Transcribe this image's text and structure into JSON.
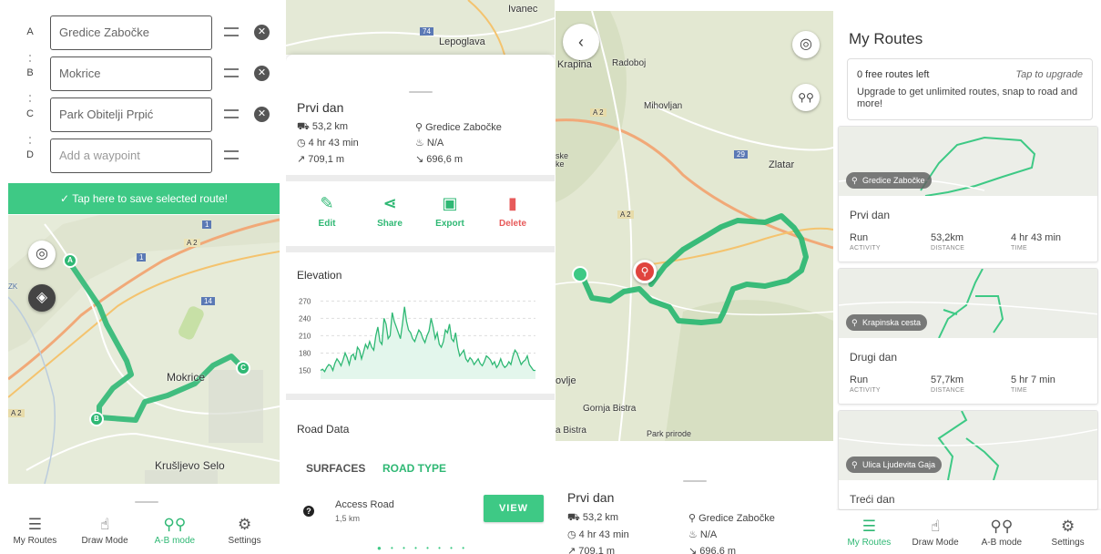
{
  "waypoint_panel": {
    "waypoints": [
      {
        "letter": "A",
        "value": "Gredice Zabočke"
      },
      {
        "letter": "B",
        "value": "Mokrice"
      },
      {
        "letter": "C",
        "value": "Park Obitelji Prpić"
      },
      {
        "letter": "D",
        "placeholder": "Add a waypoint"
      }
    ],
    "save_bar": "✓  Tap here to save selected route!",
    "map_labels": {
      "town1": "Mokrice",
      "town2": "Krušljevo Selo",
      "road_a2": "A 2",
      "road_1": "1",
      "road_14": "14",
      "left_edge": "ZK"
    },
    "markers": [
      "A",
      "B",
      "C"
    ]
  },
  "route_detail": {
    "map_labels": {
      "ivanec": "Ivanec",
      "lepoglava": "Lepoglava",
      "road_74": "74"
    },
    "title": "Prvi dan",
    "stats": {
      "distance": "53,2 km",
      "duration": "4 hr 43 min",
      "ascent": "709,1 m",
      "start": "Gredice Zabočke",
      "calories": "N/A",
      "descent": "696,6 m"
    },
    "actions": {
      "edit": "Edit",
      "share": "Share",
      "export": "Export",
      "delete": "Delete"
    },
    "elevation": {
      "title": "Elevation"
    },
    "road_data": {
      "title": "Road Data",
      "tab_surfaces": "SURFACES",
      "tab_road_type": "ROAD TYPE",
      "item_name": "Access Road",
      "item_length": "1,5 km",
      "view_button": "VIEW"
    },
    "pager": "● • • • • • • •"
  },
  "chart_data": {
    "type": "area",
    "title": "Elevation",
    "xlabel": "",
    "ylabel": "",
    "yticks": [
      150,
      180,
      210,
      240,
      270
    ],
    "ylim": [
      135,
      280
    ],
    "y": [
      150,
      152,
      148,
      155,
      160,
      158,
      150,
      162,
      170,
      165,
      158,
      168,
      180,
      172,
      160,
      175,
      178,
      168,
      190,
      185,
      170,
      182,
      195,
      188,
      200,
      190,
      185,
      210,
      225,
      200,
      195,
      240,
      230,
      205,
      210,
      250,
      235,
      225,
      215,
      205,
      230,
      260,
      235,
      220,
      215,
      205,
      200,
      210,
      220,
      215,
      205,
      198,
      210,
      218,
      240,
      225,
      205,
      215,
      195,
      190,
      200,
      220,
      215,
      230,
      205,
      200,
      215,
      190,
      175,
      180,
      185,
      170,
      165,
      172,
      168,
      160,
      165,
      170,
      162,
      158,
      165,
      175,
      172,
      168,
      160,
      165,
      155,
      160,
      170,
      160,
      155,
      158,
      165,
      160,
      175,
      185,
      180,
      170,
      160,
      165,
      168,
      175,
      160,
      155,
      150,
      150
    ]
  },
  "map_view": {
    "labels": {
      "krapina": "Krapina",
      "radoboj": "Radoboj",
      "mihovljan": "Mihovljan",
      "zlatar": "Zlatar",
      "gornja_bistra": "Gornja Bistra",
      "bistra": "a Bistra",
      "park": "Park prirode",
      "vlje": "ovlje",
      "ske": "ske\nke",
      "road_a2_top": "A 2",
      "road_a2": "A 2",
      "road_29": "29"
    },
    "title": "Prvi dan",
    "stats": {
      "distance": "53,2 km",
      "duration": "4 hr 43 min",
      "ascent": "709,1 m",
      "start": "Gredice Zabočke",
      "calories": "N/A",
      "descent": "696,6 m"
    }
  },
  "my_routes": {
    "title": "My Routes",
    "upgrade": {
      "left": "0 free routes left",
      "tap": "Tap to upgrade",
      "desc": "Upgrade to get unlimited routes, snap to road and more!"
    },
    "routes": [
      {
        "start": "Gredice Zabočke",
        "name": "Prvi dan",
        "activity": "Run",
        "distance": "53,2km",
        "time": "4 hr 43 min"
      },
      {
        "start": "Krapinska cesta",
        "name": "Drugi dan",
        "activity": "Run",
        "distance": "57,7km",
        "time": "5 hr 7 min"
      },
      {
        "start": "Ulica Ljudevita Gaja",
        "name": "Treći dan"
      }
    ],
    "labels": {
      "activity": "ACTIVITY",
      "distance": "DISTANCE",
      "time": "TIME"
    }
  },
  "nav": {
    "my_routes": "My Routes",
    "draw_mode": "Draw Mode",
    "ab_mode": "A-B mode",
    "settings": "Settings"
  },
  "colors": {
    "accent": "#3ec985",
    "route": "#2fb874",
    "delete": "#e75a5a"
  }
}
